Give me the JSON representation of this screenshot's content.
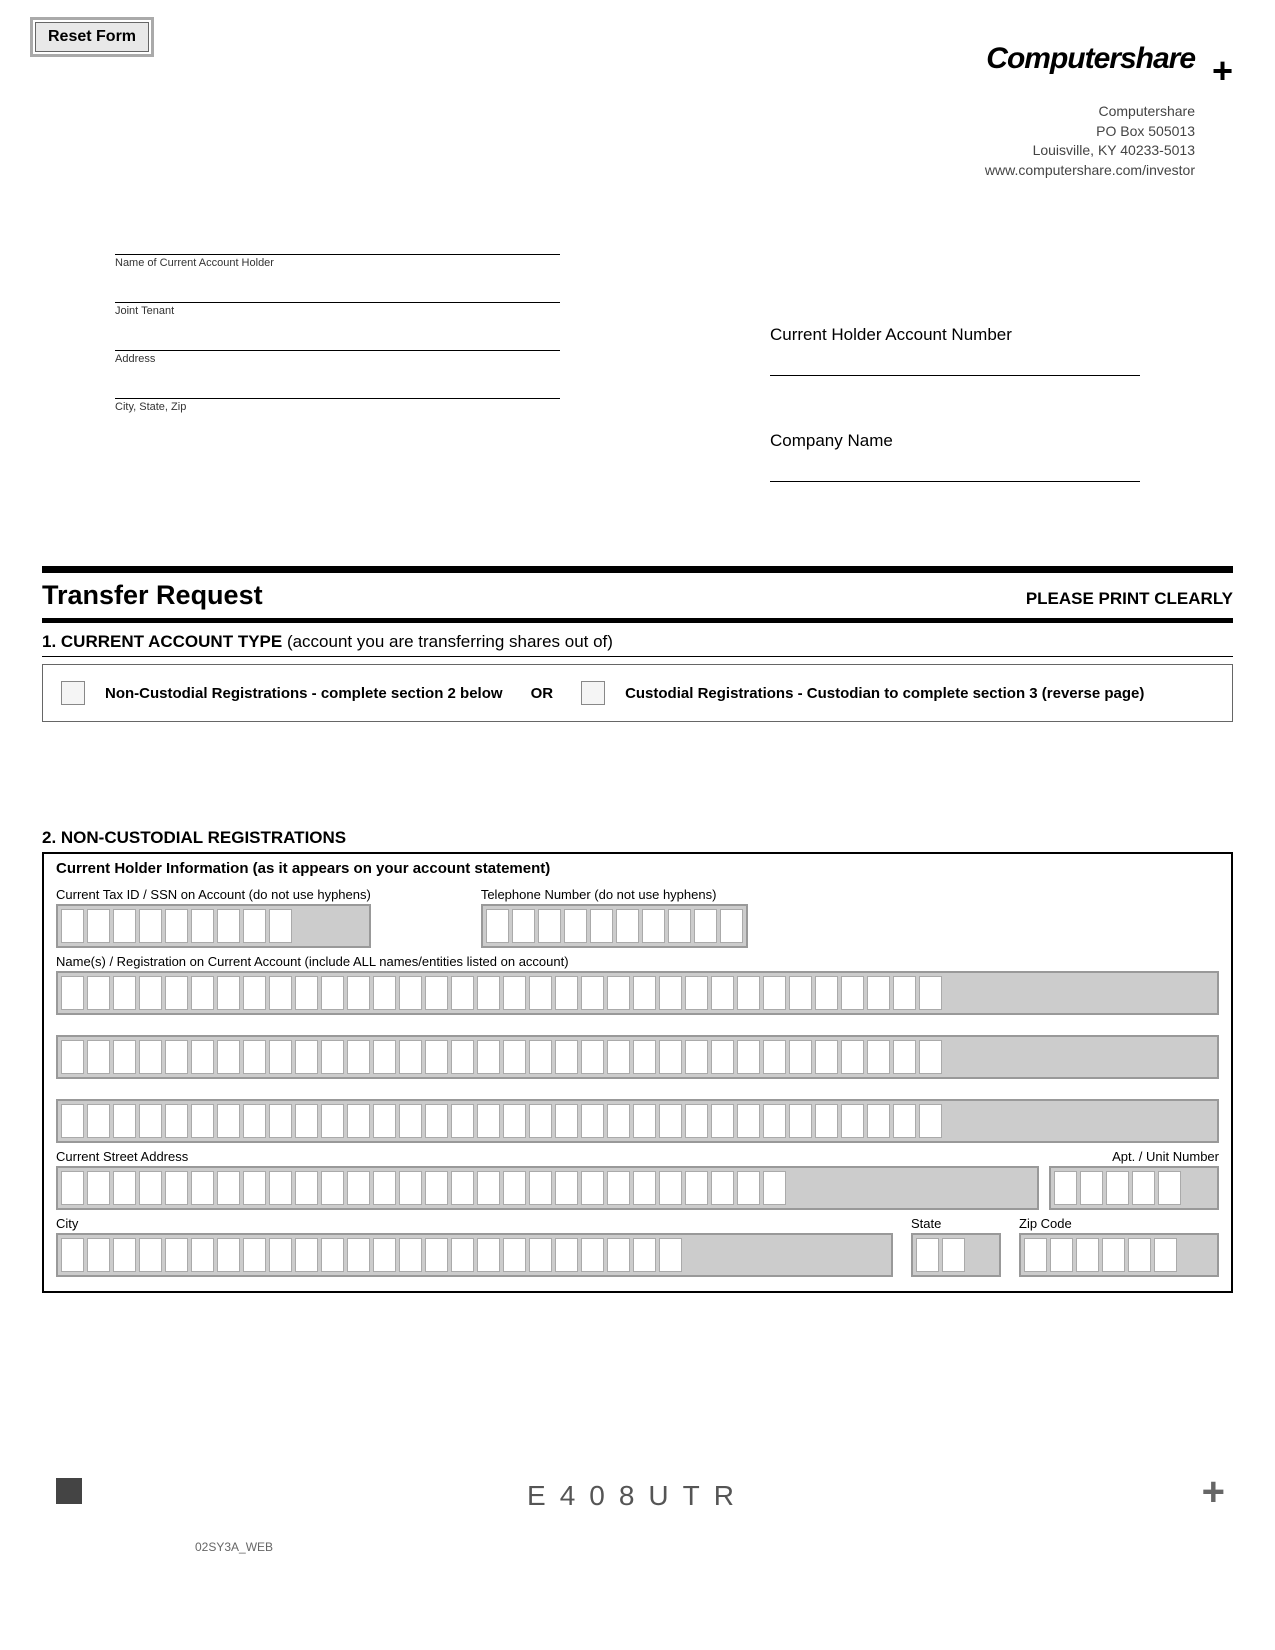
{
  "reset_button": "Reset Form",
  "logo": "Computershare",
  "company_address": {
    "name": "Computershare",
    "po": "PO Box 505013",
    "city": "Louisville, KY 40233-5013",
    "web": "www.computershare.com/investor"
  },
  "holder_fields": {
    "name": "Name of Current Account Holder",
    "joint": "Joint Tenant",
    "address": "Address",
    "csz": "City, State, Zip"
  },
  "right_fields": {
    "account_number": "Current Holder Account Number",
    "company_name": "Company Name"
  },
  "form_title": "Transfer Request",
  "print_clearly": "PLEASE PRINT CLEARLY",
  "section1": {
    "heading_bold": "1. CURRENT ACCOUNT TYPE",
    "heading_rest": " (account you are transferring shares out of)",
    "opt1": "Non-Custodial Registrations - complete section 2 below",
    "or": "OR",
    "opt2": "Custodial Registrations - Custodian to complete section 3 (reverse page)"
  },
  "section2": {
    "header": "2. NON-CUSTODIAL REGISTRATIONS",
    "subheading": "Current Holder Information (as it appears on your account statement)",
    "tax_id": "Current Tax ID / SSN on Account (do not use hyphens)",
    "phone": "Telephone Number (do not use hyphens)",
    "names": "Name(s) / Registration on Current Account (include ALL names/entities listed on account)",
    "street": "Current Street Address",
    "apt": "Apt. / Unit Number",
    "city": "City",
    "state": "State",
    "zip": "Zip Code"
  },
  "footer_code": "E408UTR",
  "doc_id": "02SY3A_WEB"
}
